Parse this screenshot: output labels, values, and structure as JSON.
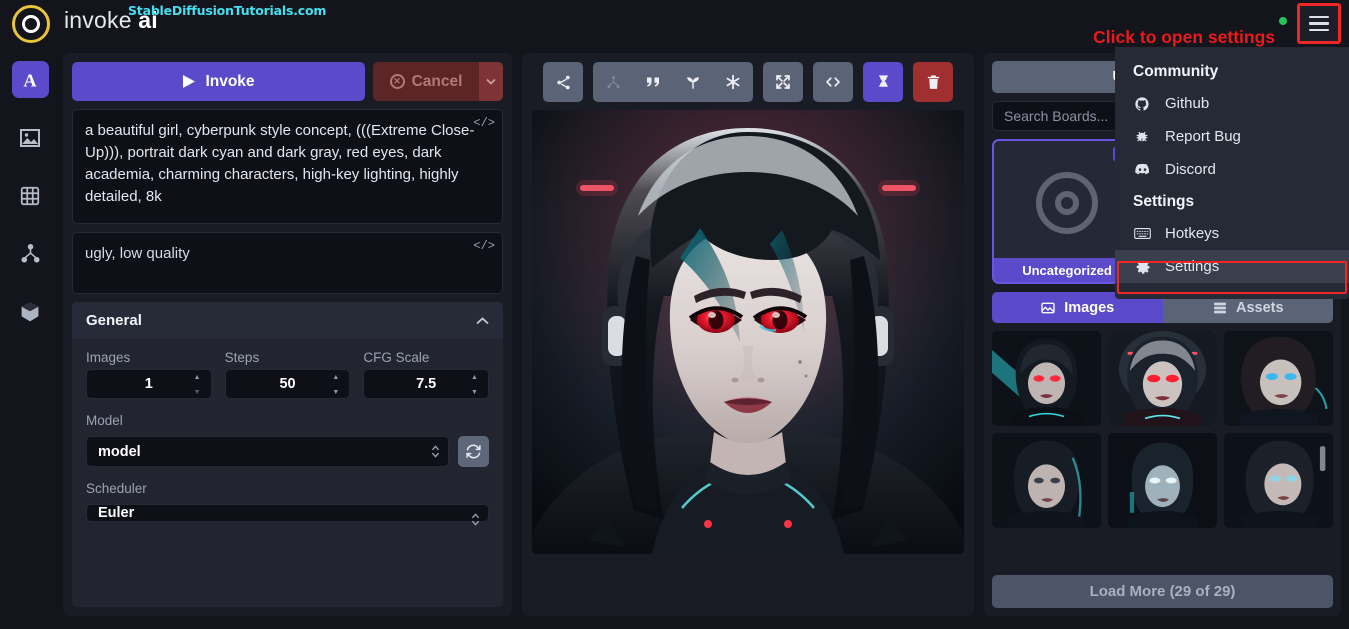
{
  "app": {
    "brand_invoke": "invoke",
    "brand_ai": "ai",
    "watermark": "StableDiffusionTutorials.com"
  },
  "annotations": {
    "settings_callout": "Click to open settings"
  },
  "rail": {
    "items": [
      {
        "name": "text-to-image",
        "icon": "letter-a-icon",
        "label": "A",
        "active": true
      },
      {
        "name": "image-to-image",
        "icon": "image-icon",
        "label": "",
        "active": false
      },
      {
        "name": "unified-canvas",
        "icon": "grid-icon",
        "label": "",
        "active": false
      },
      {
        "name": "node-editor",
        "icon": "nodes-icon",
        "label": "",
        "active": false
      },
      {
        "name": "model-manager",
        "icon": "cube-icon",
        "label": "",
        "active": false
      }
    ]
  },
  "left_panel": {
    "invoke_label": "Invoke",
    "cancel_label": "Cancel",
    "positive_prompt": "a beautiful girl, cyberpunk style concept,  (((Extreme Close-Up))), portrait dark cyan and dark gray, red eyes, dark academia, charming characters, high-key lighting, highly detailed, 8k",
    "negative_prompt": "ugly, low quality",
    "code_icon_label": "</>",
    "accordion": {
      "title": "General",
      "fields": {
        "images_label": "Images",
        "images_value": "1",
        "steps_label": "Steps",
        "steps_value": "50",
        "cfg_label": "CFG Scale",
        "cfg_value": "7.5",
        "model_label": "Model",
        "model_value": "model",
        "scheduler_label": "Scheduler",
        "scheduler_value": "Euler"
      }
    }
  },
  "center_panel": {
    "toolbar": [
      {
        "name": "share-button",
        "icon": "share-icon",
        "state": "normal"
      },
      {
        "name": "use-all-parameters-button",
        "icon": "nodes-icon",
        "state": "disabled"
      },
      {
        "name": "use-prompt-button",
        "icon": "quote-icon",
        "state": "normal"
      },
      {
        "name": "use-seed-button",
        "icon": "seed-icon",
        "state": "normal"
      },
      {
        "name": "use-all-button",
        "icon": "asterisk-icon",
        "state": "normal"
      },
      {
        "name": "fullscreen-button",
        "icon": "expand-icon",
        "state": "normal"
      },
      {
        "name": "metadata-button",
        "icon": "code-icon",
        "state": "normal"
      },
      {
        "name": "progress-button",
        "icon": "hourglass-icon",
        "state": "accent"
      },
      {
        "name": "delete-button",
        "icon": "trash-icon",
        "state": "danger"
      }
    ]
  },
  "right_panel": {
    "board_select_label": "Uncategorized",
    "search_placeholder": "Search Boards...",
    "board_card": {
      "caption": "Uncategorized",
      "badge": "A"
    },
    "tabs": [
      {
        "label": "Images",
        "icon": "images-icon",
        "active": true
      },
      {
        "label": "Assets",
        "icon": "assets-icon",
        "active": false
      }
    ],
    "load_more_label": "Load More (29 of 29)"
  },
  "menu": {
    "sections": [
      {
        "title": "Community",
        "items": [
          {
            "label": "Github",
            "icon": "github-icon",
            "highlight": false
          },
          {
            "label": "Report Bug",
            "icon": "bug-icon",
            "highlight": false
          },
          {
            "label": "Discord",
            "icon": "discord-icon",
            "highlight": false
          }
        ]
      },
      {
        "title": "Settings",
        "items": [
          {
            "label": "Hotkeys",
            "icon": "keyboard-icon",
            "highlight": false
          },
          {
            "label": "Settings",
            "icon": "gear-icon",
            "highlight": true
          }
        ]
      }
    ]
  },
  "colors": {
    "accent_purple": "#5b4ac9",
    "danger_red": "#a03030",
    "annotation_red": "#ef2626",
    "watermark_cyan": "#45e0f0",
    "panel_bg": "#1a1c25",
    "app_bg": "#14151c",
    "status_green": "#25c55e",
    "logo_gold": "#e8c33c"
  }
}
